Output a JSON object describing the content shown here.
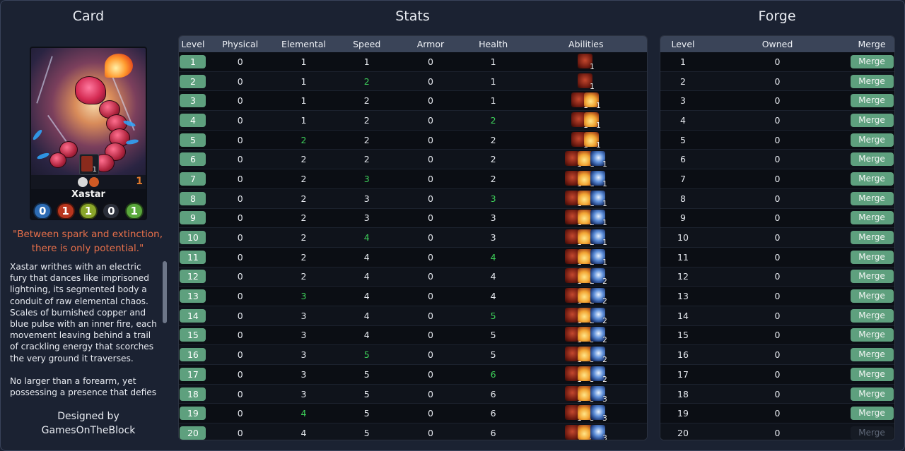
{
  "headers": {
    "card": "Card",
    "stats": "Stats",
    "forge": "Forge"
  },
  "card": {
    "name": "Xastar",
    "cost": "1",
    "level": "1",
    "stat_values": [
      "0",
      "1",
      "1",
      "0",
      "1"
    ],
    "stat_colors": [
      "#2d6cb4",
      "#b8361e",
      "#8aa62a",
      "#2b2f3a",
      "#5aa83c"
    ],
    "flavor": "\"Between spark and extinction, there is only potential.\"",
    "description_paragraphs": [
      "Xastar writhes with an electric fury that dances like imprisoned lightning, its segmented body a conduit of raw elemental chaos. Scales of burnished copper and blue pulse with an inner fire, each movement leaving behind a trail of crackling energy that scorches the very ground it traverses.",
      "No larger than a forearm, yet possessing a presence that defies its diminutive size, Xastar is a volatile"
    ],
    "designer_label": "Designed by",
    "designer_name": "GamesOnTheBlock"
  },
  "stats_table": {
    "columns": [
      "Level",
      "Physical",
      "Elemental",
      "Speed",
      "Armor",
      "Health",
      "Abilities"
    ],
    "rows": [
      {
        "level": "1",
        "physical": "0",
        "elemental": "1",
        "speed": "1",
        "armor": "0",
        "health": "1",
        "hl": [],
        "abilities": [
          [
            "claw",
            "1"
          ]
        ]
      },
      {
        "level": "2",
        "physical": "0",
        "elemental": "1",
        "speed": "2",
        "armor": "0",
        "health": "1",
        "hl": [
          "speed"
        ],
        "abilities": [
          [
            "claw",
            "1"
          ]
        ]
      },
      {
        "level": "3",
        "physical": "0",
        "elemental": "1",
        "speed": "2",
        "armor": "0",
        "health": "1",
        "hl": [],
        "abilities": [
          [
            "claw",
            "1"
          ],
          [
            "fire",
            "1"
          ]
        ]
      },
      {
        "level": "4",
        "physical": "0",
        "elemental": "1",
        "speed": "2",
        "armor": "0",
        "health": "2",
        "hl": [
          "health"
        ],
        "abilities": [
          [
            "claw",
            "1"
          ],
          [
            "fire",
            "1"
          ]
        ]
      },
      {
        "level": "5",
        "physical": "0",
        "elemental": "2",
        "speed": "2",
        "armor": "0",
        "health": "2",
        "hl": [
          "elemental"
        ],
        "abilities": [
          [
            "claw",
            "1"
          ],
          [
            "fire",
            "1"
          ]
        ]
      },
      {
        "level": "6",
        "physical": "0",
        "elemental": "2",
        "speed": "2",
        "armor": "0",
        "health": "2",
        "hl": [],
        "abilities": [
          [
            "claw",
            "1"
          ],
          [
            "fire",
            "1"
          ],
          [
            "ice",
            "1"
          ]
        ]
      },
      {
        "level": "7",
        "physical": "0",
        "elemental": "2",
        "speed": "3",
        "armor": "0",
        "health": "2",
        "hl": [
          "speed"
        ],
        "abilities": [
          [
            "claw",
            "1"
          ],
          [
            "fire",
            "1"
          ],
          [
            "ice",
            "1"
          ]
        ]
      },
      {
        "level": "8",
        "physical": "0",
        "elemental": "2",
        "speed": "3",
        "armor": "0",
        "health": "3",
        "hl": [
          "health"
        ],
        "abilities": [
          [
            "claw",
            "1"
          ],
          [
            "fire",
            "1"
          ],
          [
            "ice",
            "1"
          ]
        ]
      },
      {
        "level": "9",
        "physical": "0",
        "elemental": "2",
        "speed": "3",
        "armor": "0",
        "health": "3",
        "hl": [],
        "abilities": [
          [
            "claw",
            "1"
          ],
          [
            "fire",
            "2"
          ],
          [
            "ice",
            "1"
          ]
        ]
      },
      {
        "level": "10",
        "physical": "0",
        "elemental": "2",
        "speed": "4",
        "armor": "0",
        "health": "3",
        "hl": [
          "speed"
        ],
        "abilities": [
          [
            "claw",
            "1"
          ],
          [
            "fire",
            "2"
          ],
          [
            "ice",
            "1"
          ]
        ]
      },
      {
        "level": "11",
        "physical": "0",
        "elemental": "2",
        "speed": "4",
        "armor": "0",
        "health": "4",
        "hl": [
          "health"
        ],
        "abilities": [
          [
            "claw",
            "1"
          ],
          [
            "fire",
            "2"
          ],
          [
            "ice",
            "1"
          ]
        ]
      },
      {
        "level": "12",
        "physical": "0",
        "elemental": "2",
        "speed": "4",
        "armor": "0",
        "health": "4",
        "hl": [],
        "abilities": [
          [
            "claw",
            "1"
          ],
          [
            "fire",
            "2"
          ],
          [
            "ice",
            "2"
          ]
        ]
      },
      {
        "level": "13",
        "physical": "0",
        "elemental": "3",
        "speed": "4",
        "armor": "0",
        "health": "4",
        "hl": [
          "elemental"
        ],
        "abilities": [
          [
            "claw",
            "1"
          ],
          [
            "fire",
            "2"
          ],
          [
            "ice",
            "2"
          ]
        ]
      },
      {
        "level": "14",
        "physical": "0",
        "elemental": "3",
        "speed": "4",
        "armor": "0",
        "health": "5",
        "hl": [
          "health"
        ],
        "abilities": [
          [
            "claw",
            "1"
          ],
          [
            "fire",
            "2"
          ],
          [
            "ice",
            "2"
          ]
        ]
      },
      {
        "level": "15",
        "physical": "0",
        "elemental": "3",
        "speed": "4",
        "armor": "0",
        "health": "5",
        "hl": [],
        "abilities": [
          [
            "claw",
            "1"
          ],
          [
            "fire",
            "3"
          ],
          [
            "ice",
            "2"
          ]
        ]
      },
      {
        "level": "16",
        "physical": "0",
        "elemental": "3",
        "speed": "5",
        "armor": "0",
        "health": "5",
        "hl": [
          "speed"
        ],
        "abilities": [
          [
            "claw",
            "1"
          ],
          [
            "fire",
            "3"
          ],
          [
            "ice",
            "2"
          ]
        ]
      },
      {
        "level": "17",
        "physical": "0",
        "elemental": "3",
        "speed": "5",
        "armor": "0",
        "health": "6",
        "hl": [
          "health"
        ],
        "abilities": [
          [
            "claw",
            "1"
          ],
          [
            "fire",
            "3"
          ],
          [
            "ice",
            "2"
          ]
        ]
      },
      {
        "level": "18",
        "physical": "0",
        "elemental": "3",
        "speed": "5",
        "armor": "0",
        "health": "6",
        "hl": [],
        "abilities": [
          [
            "claw",
            "1"
          ],
          [
            "fire",
            "3"
          ],
          [
            "ice",
            "3"
          ]
        ]
      },
      {
        "level": "19",
        "physical": "0",
        "elemental": "4",
        "speed": "5",
        "armor": "0",
        "health": "6",
        "hl": [
          "elemental"
        ],
        "abilities": [
          [
            "claw",
            "1"
          ],
          [
            "fire",
            "3"
          ],
          [
            "ice",
            "3"
          ]
        ]
      },
      {
        "level": "20",
        "physical": "0",
        "elemental": "4",
        "speed": "5",
        "armor": "0",
        "health": "6",
        "hl": [],
        "abilities": [
          [
            "claw",
            "1"
          ],
          [
            "fire",
            "4"
          ],
          [
            "ice",
            "3"
          ]
        ]
      }
    ]
  },
  "forge_table": {
    "columns": [
      "Level",
      "Owned",
      "Merge"
    ],
    "merge_label": "Merge",
    "rows": [
      {
        "level": "1",
        "owned": "0",
        "enabled": true
      },
      {
        "level": "2",
        "owned": "0",
        "enabled": true
      },
      {
        "level": "3",
        "owned": "0",
        "enabled": true
      },
      {
        "level": "4",
        "owned": "0",
        "enabled": true
      },
      {
        "level": "5",
        "owned": "0",
        "enabled": true
      },
      {
        "level": "6",
        "owned": "0",
        "enabled": true
      },
      {
        "level": "7",
        "owned": "0",
        "enabled": true
      },
      {
        "level": "8",
        "owned": "0",
        "enabled": true
      },
      {
        "level": "9",
        "owned": "0",
        "enabled": true
      },
      {
        "level": "10",
        "owned": "0",
        "enabled": true
      },
      {
        "level": "11",
        "owned": "0",
        "enabled": true
      },
      {
        "level": "12",
        "owned": "0",
        "enabled": true
      },
      {
        "level": "13",
        "owned": "0",
        "enabled": true
      },
      {
        "level": "14",
        "owned": "0",
        "enabled": true
      },
      {
        "level": "15",
        "owned": "0",
        "enabled": true
      },
      {
        "level": "16",
        "owned": "0",
        "enabled": true
      },
      {
        "level": "17",
        "owned": "0",
        "enabled": true
      },
      {
        "level": "18",
        "owned": "0",
        "enabled": true
      },
      {
        "level": "19",
        "owned": "0",
        "enabled": true
      },
      {
        "level": "20",
        "owned": "0",
        "enabled": false
      }
    ]
  },
  "colors": {
    "background": "#1b2232",
    "button_green": "#5ea07e",
    "highlight_green": "#3ed15a",
    "flavor_orange": "#e8704a",
    "header_bar": "#3a4458"
  }
}
